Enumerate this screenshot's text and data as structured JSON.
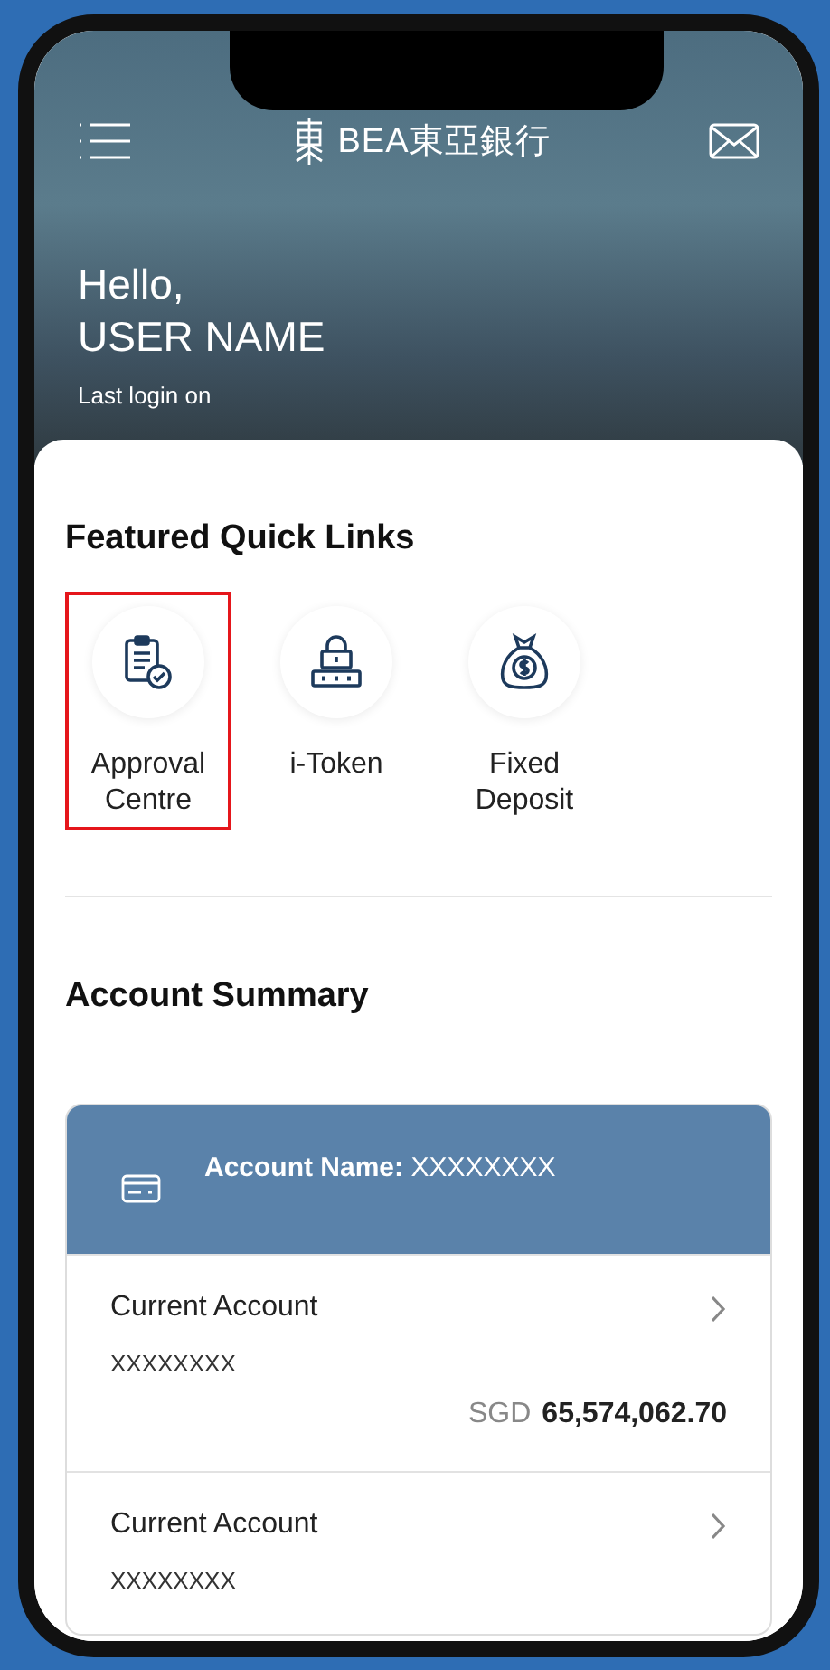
{
  "header": {
    "brand": "BEA東亞銀行"
  },
  "greeting": {
    "hello": "Hello,",
    "name": "USER NAME",
    "last_login": "Last login on"
  },
  "quick_links": {
    "title": "Featured Quick Links",
    "items": [
      {
        "kind": "approval",
        "label": "Approval Centre",
        "highlighted": true
      },
      {
        "kind": "token",
        "label": "i-Token",
        "highlighted": false
      },
      {
        "kind": "deposit",
        "label": "Fixed Deposit",
        "highlighted": false
      }
    ]
  },
  "account_summary": {
    "title": "Account Summary",
    "account_label": "Account Name:",
    "account_name": "XXXXXXXX",
    "accounts": [
      {
        "type": "Current Account",
        "number": "XXXXXXXX",
        "currency": "SGD",
        "balance": "65,574,062.70"
      },
      {
        "type": "Current Account",
        "number": "XXXXXXXX"
      }
    ]
  }
}
